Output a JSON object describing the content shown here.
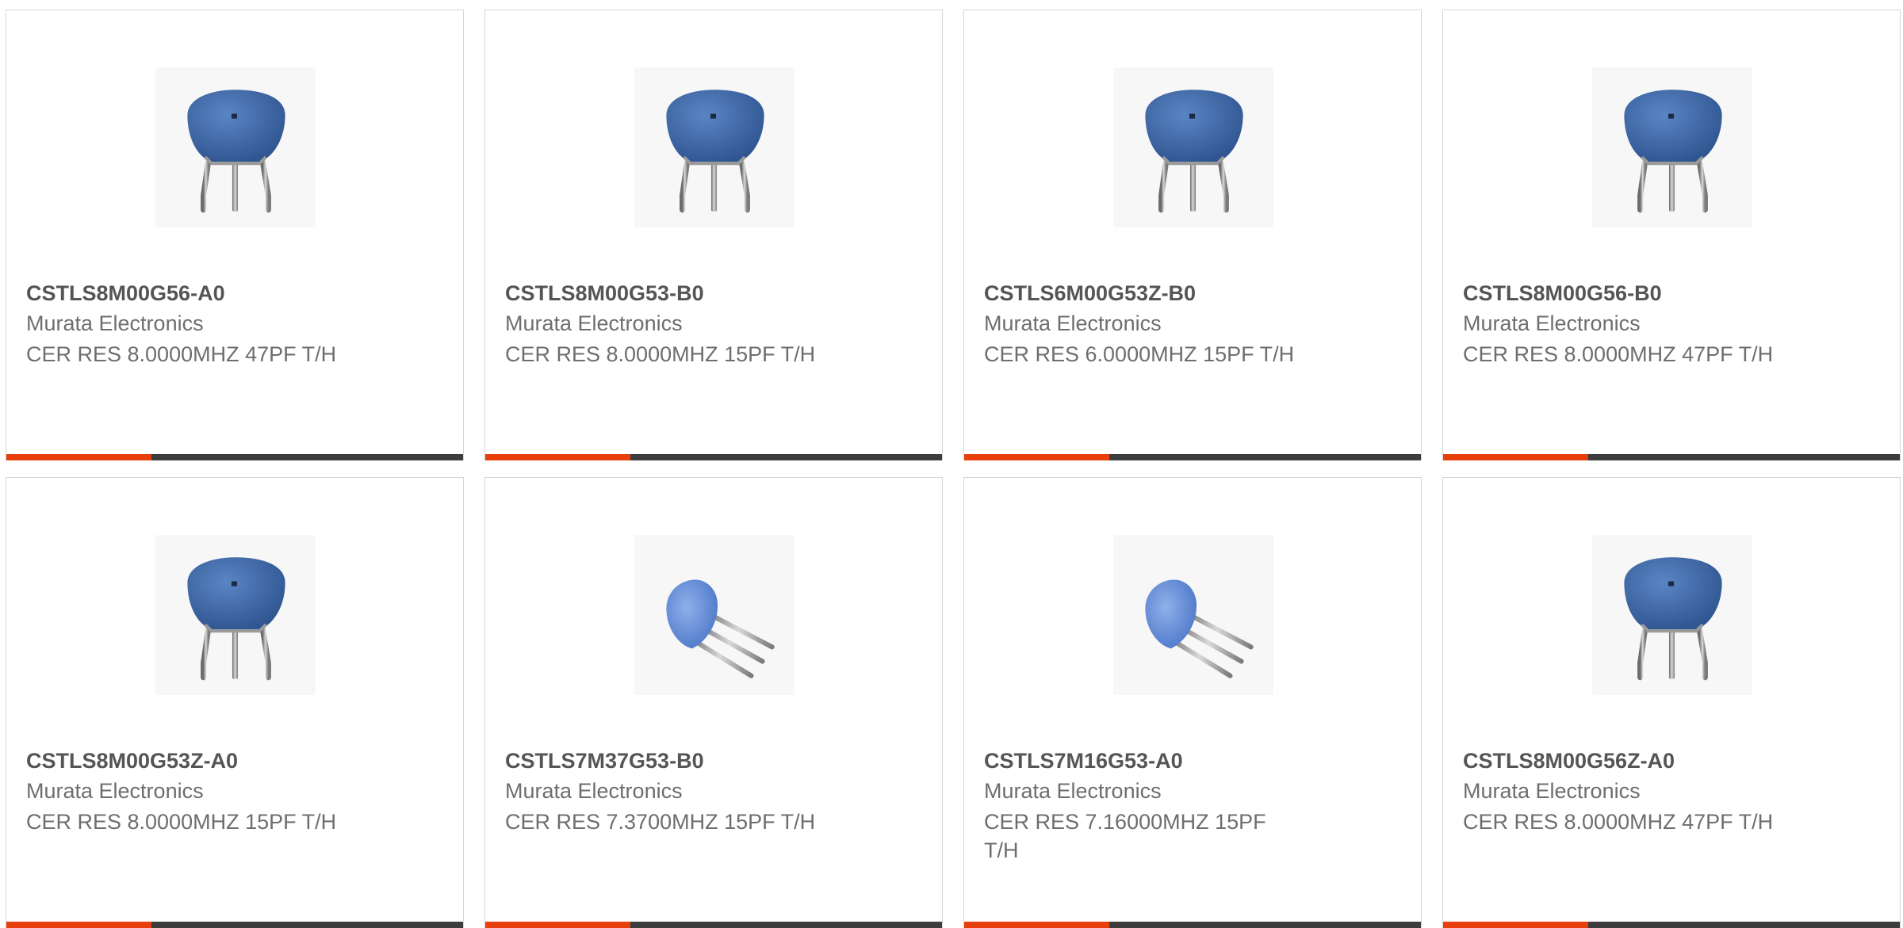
{
  "theme": {
    "accent": "#e8400c",
    "bar_dark": "#3d3d3d",
    "component_blue": "#3f6aa8"
  },
  "products": [
    {
      "part_number": "CSTLS8M00G56-A0",
      "manufacturer": "Murata Electronics",
      "description": "CER RES 8.0000MHZ 47PF T/H",
      "image_icon": "ceramic-resonator-front-icon"
    },
    {
      "part_number": "CSTLS8M00G53-B0",
      "manufacturer": "Murata Electronics",
      "description": "CER RES 8.0000MHZ 15PF T/H",
      "image_icon": "ceramic-resonator-front-icon"
    },
    {
      "part_number": "CSTLS6M00G53Z-B0",
      "manufacturer": "Murata Electronics",
      "description": "CER RES 6.0000MHZ 15PF T/H",
      "image_icon": "ceramic-resonator-front-icon"
    },
    {
      "part_number": "CSTLS8M00G56-B0",
      "manufacturer": "Murata Electronics",
      "description": "CER RES 8.0000MHZ 47PF T/H",
      "image_icon": "ceramic-resonator-front-icon"
    },
    {
      "part_number": "CSTLS8M00G53Z-A0",
      "manufacturer": "Murata Electronics",
      "description": "CER RES 8.0000MHZ 15PF T/H",
      "image_icon": "ceramic-resonator-front-icon"
    },
    {
      "part_number": "CSTLS7M37G53-B0",
      "manufacturer": "Murata Electronics",
      "description": "CER RES 7.3700MHZ 15PF T/H",
      "image_icon": "ceramic-resonator-angled-icon"
    },
    {
      "part_number": "CSTLS7M16G53-A0",
      "manufacturer": "Murata Electronics",
      "description": "CER RES 7.16000MHZ 15PF T/H",
      "image_icon": "ceramic-resonator-angled-icon"
    },
    {
      "part_number": "CSTLS8M00G56Z-A0",
      "manufacturer": "Murata Electronics",
      "description": "CER RES 8.0000MHZ 47PF T/H",
      "image_icon": "ceramic-resonator-front-icon"
    }
  ]
}
